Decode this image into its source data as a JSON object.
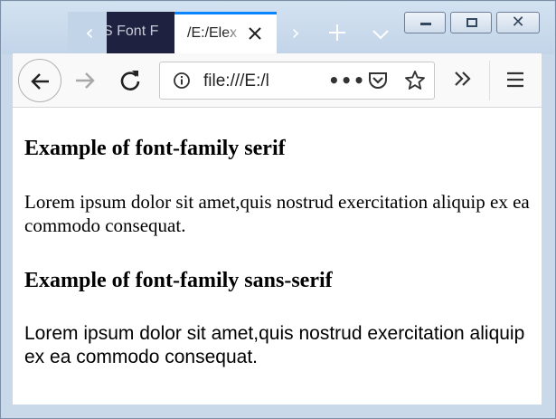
{
  "tabs": [
    {
      "title": "S Font F"
    },
    {
      "title": "/E:/Elex"
    }
  ],
  "urlbar": {
    "value": "file:///E:/l"
  },
  "content": {
    "heading_serif": "Example of font-family serif",
    "para_serif": "Lorem ipsum dolor sit amet,quis nostrud exercitation aliquip ex ea commodo consequat.",
    "heading_sans": "Example of font-family sans-serif",
    "para_sans": "Lorem ipsum dolor sit amet,quis nostrud exercitation aliquip ex ea commodo consequat."
  },
  "icons": {
    "tab_scroll_left": "chevron-left-icon",
    "tab_close": "close-icon",
    "tab_scroll_right": "chevron-right-icon",
    "new_tab": "plus-icon",
    "all_tabs": "chevron-down-icon",
    "minimize": "minimize-icon",
    "maximize": "maximize-icon",
    "close_window": "close-icon",
    "back": "arrow-left-icon",
    "forward": "arrow-right-icon",
    "reload": "reload-icon",
    "site_info": "info-icon",
    "page_actions": "ellipsis-icon",
    "pocket": "pocket-icon",
    "bookmark": "star-icon",
    "overflow": "double-chevron-icon",
    "menu": "hamburger-icon"
  },
  "colors": {
    "tab_accent": "#0a84ff",
    "inactive_tab": "#1e2240",
    "frame": "#c9d9ea"
  }
}
